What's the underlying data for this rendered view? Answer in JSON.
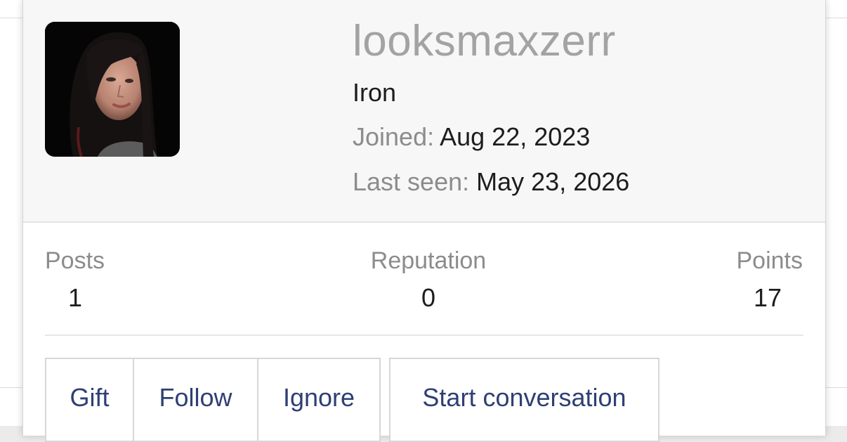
{
  "profile": {
    "username": "looksmaxzerr",
    "user_title": "Iron",
    "joined_label": "Joined:",
    "joined_value": "Aug 22, 2023",
    "last_seen_label": "Last seen:",
    "last_seen_value": "May 23, 2026"
  },
  "stats": [
    {
      "label": "Posts",
      "value": "1"
    },
    {
      "label": "Reputation",
      "value": "0"
    },
    {
      "label": "Points",
      "value": "17"
    }
  ],
  "actions": {
    "gift": "Gift",
    "follow": "Follow",
    "ignore": "Ignore",
    "start_conversation": "Start conversation"
  },
  "colors": {
    "header_bg": "#f7f7f7",
    "username": "#a3a3a3",
    "label": "#8c8c8c",
    "text": "#1d1d1d",
    "button_text": "#2e3f74",
    "border": "#d7d7d7"
  },
  "icons": {
    "avatar": "user-avatar-photo"
  }
}
